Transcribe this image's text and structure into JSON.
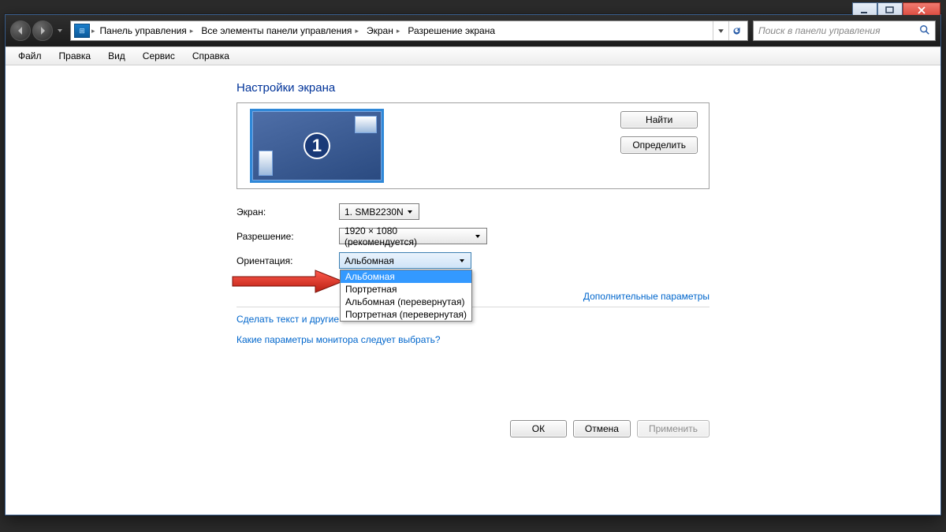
{
  "window_controls": {
    "min": "minimize",
    "max": "maximize",
    "close": "close"
  },
  "breadcrumb": {
    "items": [
      "Панель управления",
      "Все элементы панели управления",
      "Экран",
      "Разрешение экрана"
    ]
  },
  "search": {
    "placeholder": "Поиск в панели управления"
  },
  "menu": {
    "file": "Файл",
    "edit": "Правка",
    "view": "Вид",
    "tools": "Сервис",
    "help": "Справка"
  },
  "page": {
    "title": "Настройки экрана",
    "detect_btn": "Найти",
    "identify_btn": "Определить",
    "monitor_number": "1",
    "labels": {
      "display": "Экран:",
      "resolution": "Разрешение:",
      "orientation": "Ориентация:"
    },
    "display_value": "1. SMB2230N",
    "resolution_value": "1920 × 1080 (рекомендуется)",
    "orientation_value": "Альбомная",
    "orientation_options": [
      "Альбомная",
      "Портретная",
      "Альбомная (перевернутая)",
      "Портретная (перевернутая)"
    ],
    "advanced_link": "Дополнительные параметры",
    "text_size_link": "Сделать текст и другие",
    "which_monitor_link": "Какие параметры монитора следует выбрать?",
    "ok": "ОК",
    "cancel": "Отмена",
    "apply": "Применить"
  }
}
